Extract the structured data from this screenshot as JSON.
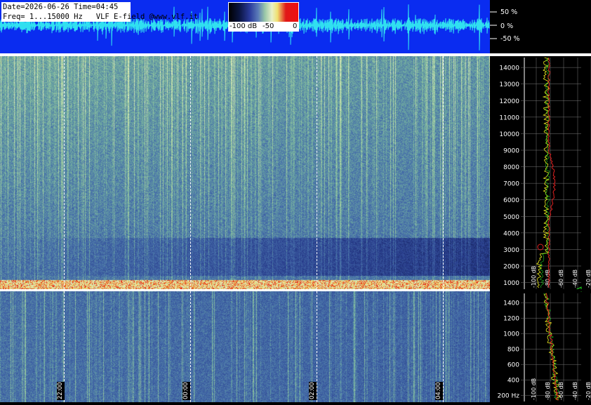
{
  "header": {
    "line1": "Date=2026-06-26 Time=04:45",
    "line2": "Freq= 1...15000 Hz   VLF E-field @www.vlf.it"
  },
  "colorbar": {
    "labels": [
      "-100 dB",
      "-50",
      "0"
    ]
  },
  "waveform": {
    "scale_labels": [
      "50 %",
      "0 %",
      "-50 %"
    ]
  },
  "time_axis": {
    "labels": [
      "22:00",
      "00:00",
      "02:00",
      "04:00"
    ]
  },
  "upper_spectrum": {
    "freq_labels": [
      "14000",
      "13000",
      "12000",
      "11000",
      "10000",
      "9000",
      "8000",
      "7000",
      "6000",
      "5000",
      "4000",
      "3000",
      "2000",
      "1000"
    ],
    "db_labels": [
      "-100 dB",
      "-80 dB",
      "-60 dB",
      "-40 dB",
      "-20 dB"
    ]
  },
  "lower_spectrum": {
    "freq_labels": [
      "1400",
      "1200",
      "1000",
      "800",
      "600",
      "400",
      "200 Hz"
    ],
    "db_labels": [
      "-100 dB",
      "-80 dB",
      "-60 dB",
      "-40 dB",
      "-20 dB"
    ]
  },
  "colors": {
    "waveform_bg": "#0a2cf0",
    "waveform_trace": "#30e0f0",
    "accent_red": "#e01818",
    "trace_yellow": "#f0f020",
    "trace_green": "#20e020"
  }
}
